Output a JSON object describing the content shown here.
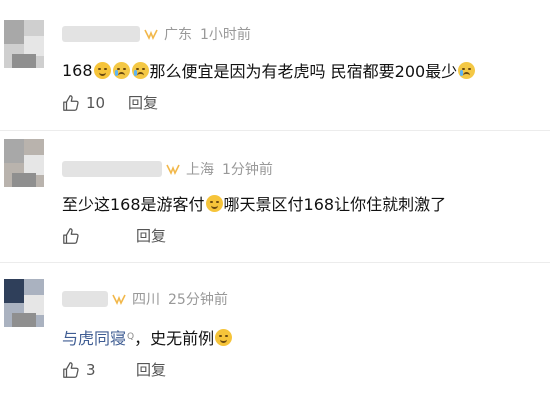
{
  "comments": [
    {
      "location": "广东",
      "time": "1小时前",
      "text_parts": [
        "168",
        "那么便宜是因为有老虎吗 民宿都要200最少"
      ],
      "likes": "10",
      "reply_label": "回复"
    },
    {
      "location": "上海",
      "time": "1分钟前",
      "text_parts": [
        "至少这168是游客付",
        "哪天景区付168让你住就刺激了"
      ],
      "likes": "",
      "reply_label": "回复"
    },
    {
      "location": "四川",
      "time": "25分钟前",
      "link_text": "与虎同寝",
      "link_badge": "Q",
      "text_parts": [
        "，史无前例"
      ],
      "likes": "3",
      "reply_label": "回复"
    }
  ],
  "colors": {
    "link": "#3f5d93",
    "meta": "#999999",
    "vip": "#f2b84b"
  },
  "icons": {
    "like": "thumbs-up-icon",
    "vip": "vip-badge-icon",
    "emoji": "emoji-icon"
  }
}
